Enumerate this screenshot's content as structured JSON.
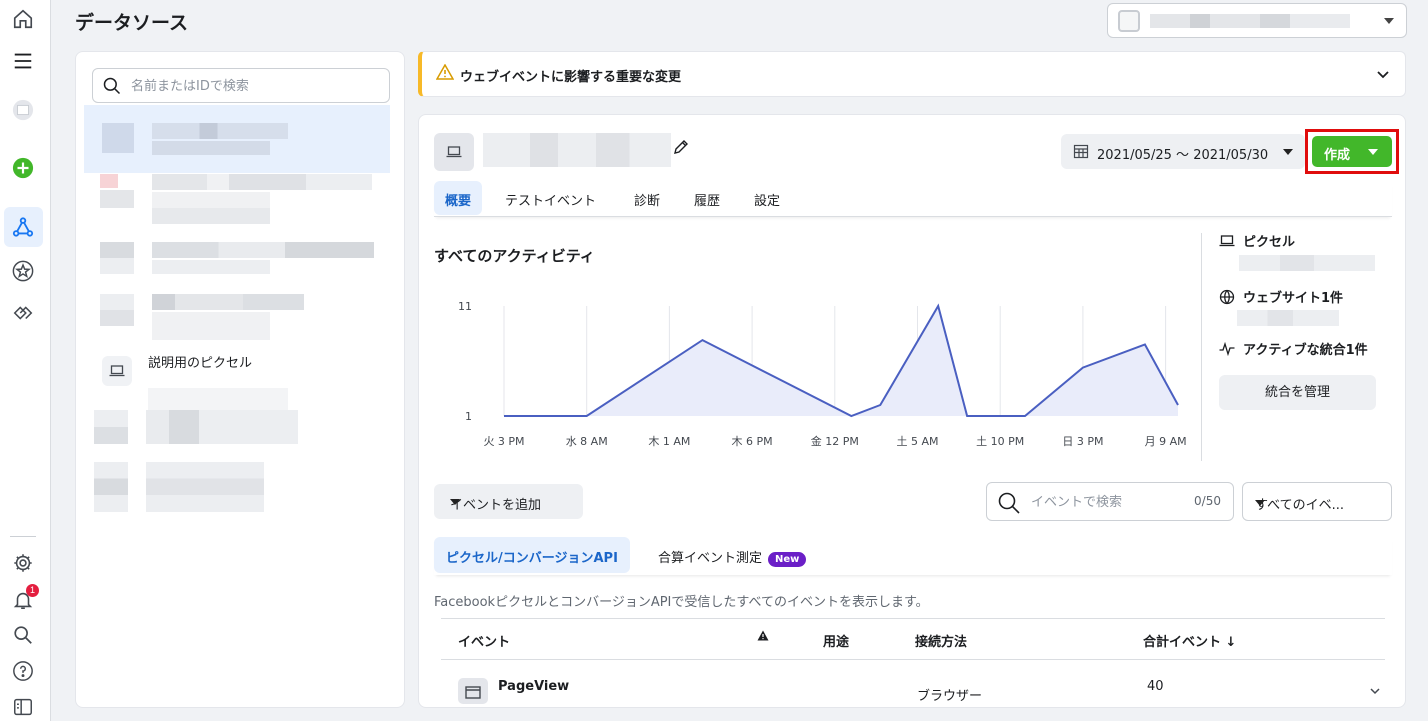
{
  "header": {
    "title": "データソース"
  },
  "rail": {
    "icons": [
      "home-icon",
      "menu-icon",
      "account-avatar-icon",
      "add-icon",
      "events-manager-icon",
      "star-icon",
      "partner-icon",
      "settings-icon",
      "notifications-icon",
      "search-icon",
      "help-icon",
      "toggle-panel-icon"
    ],
    "notification_count": "1"
  },
  "sidebar": {
    "search_placeholder": "名前またはIDで検索",
    "pixel_label": "説明用のピクセル"
  },
  "banner": {
    "text": "ウェブイベントに影響する重要な変更"
  },
  "main": {
    "date_range": "2021/05/25 〜 2021/05/30",
    "create_label": "作成",
    "tabs": [
      "概要",
      "テストイベント",
      "診断",
      "履歴",
      "設定"
    ],
    "active_tab": "概要",
    "section_title": "すべてのアクティビティ",
    "side": {
      "pixel_heading": "ピクセル",
      "website_heading": "ウェブサイト1件",
      "integration_heading": "アクティブな統合1件",
      "manage_label": "統合を管理"
    },
    "add_event_label": "イベントを追加",
    "event_search_placeholder": "イベントで検索",
    "event_count": "0/50",
    "event_filter": "すべてのイベ...",
    "subtabs": [
      "ピクセル/コンバージョンAPI",
      "合算イベント測定"
    ],
    "new_badge": "New",
    "description": "FacebookピクセルとコンバージョンAPIで受信したすべてのイベントを表示します。",
    "table": {
      "columns": [
        "イベント",
        "",
        "用途",
        "接続方法",
        "合計イベント ↓"
      ],
      "rows": [
        {
          "event": "PageView",
          "connection": "ブラウザー",
          "total": "40"
        }
      ]
    }
  },
  "chart_data": {
    "type": "area",
    "title": "すべてのアクティビティ",
    "x_ticks": [
      "火 3 PM",
      "水 8 AM",
      "木 1 AM",
      "木 6 PM",
      "金 12 PM",
      "土 5 AM",
      "土 10 PM",
      "日 3 PM",
      "月 9 AM"
    ],
    "y_ticks": [
      1,
      11
    ],
    "ylim": [
      1,
      11
    ],
    "series": [
      {
        "x": [
          0,
          1,
          2.4,
          4.2,
          4.55,
          5.25,
          5.6,
          6.3,
          7.0,
          7.75,
          8.15
        ],
        "values": [
          1,
          1,
          7.9,
          1,
          2,
          11,
          1,
          1,
          5.4,
          7.5,
          2
        ],
        "color": "#4a5fc1"
      }
    ]
  }
}
